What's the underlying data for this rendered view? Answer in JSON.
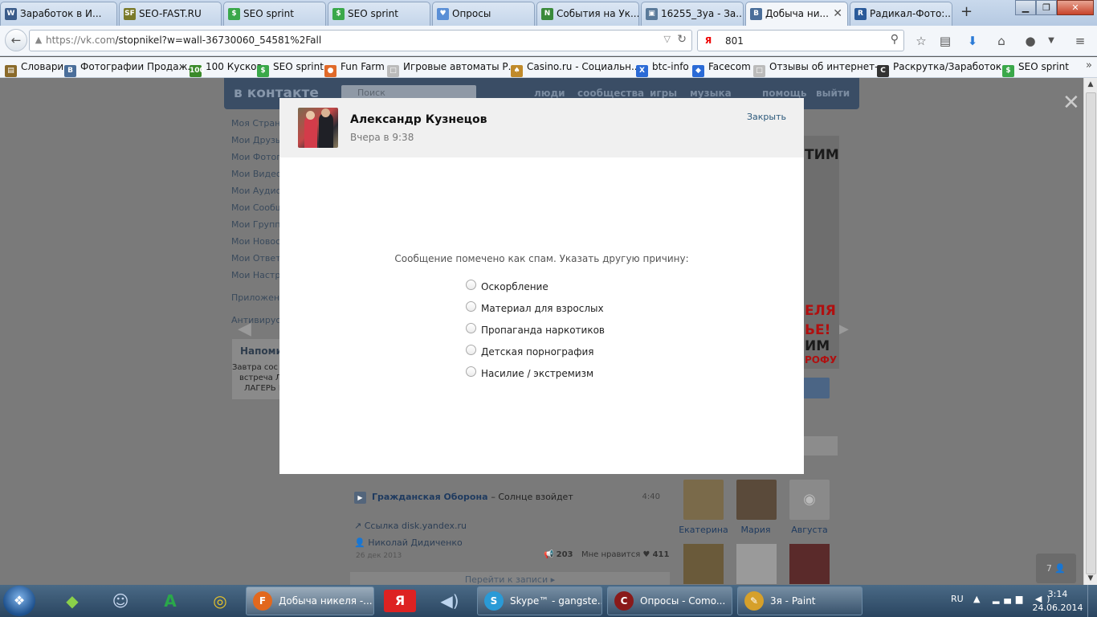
{
  "browser": {
    "tabs": [
      {
        "label": "Заработок в И...",
        "icon": "doll-zona-icon",
        "color": "#3b5c8a",
        "glyph": "W"
      },
      {
        "label": "SEO-FAST.RU",
        "icon": "seo-fast-icon",
        "color": "#7a7a2a",
        "glyph": "SF"
      },
      {
        "label": "SEO sprint",
        "icon": "seo-sprint-icon",
        "color": "#3aa84a",
        "glyph": "$"
      },
      {
        "label": "SEO sprint",
        "icon": "seo-sprint-icon",
        "color": "#3aa84a",
        "glyph": "$"
      },
      {
        "label": "Опросы",
        "icon": "heart-icon",
        "color": "#5a8fd6",
        "glyph": "♥"
      },
      {
        "label": "События на Ук...",
        "icon": "news-icon",
        "color": "#3a8a3a",
        "glyph": "N"
      },
      {
        "label": "16255_3уа - За...",
        "icon": "image-icon",
        "color": "#5a7a9a",
        "glyph": "▣"
      },
      {
        "label": "Добыча ни...",
        "icon": "vk-icon",
        "color": "#4a6e9a",
        "glyph": "B"
      },
      {
        "label": "Радикал-Фото:...",
        "icon": "radical-icon",
        "color": "#2a5a9a",
        "glyph": "R"
      }
    ],
    "url_host": "https://vk.com",
    "url_path": "/stopnikel?w=wall-36730060_54581%2Fall",
    "search_value": "801",
    "bookmarks": [
      {
        "label": "Словари",
        "color": "#8a6a2a",
        "glyph": "▤"
      },
      {
        "label": "Фотографии Продаж...",
        "color": "#4a6e9a",
        "glyph": "B"
      },
      {
        "label": "100 Кусков",
        "color": "#3a8a2a",
        "glyph": "100"
      },
      {
        "label": "SEO sprint",
        "color": "#3aa84a",
        "glyph": "$"
      },
      {
        "label": "Fun Farm",
        "color": "#e06a2a",
        "glyph": "●"
      },
      {
        "label": "Игровые автоматы Р...",
        "color": "#bbbbbb",
        "glyph": "□"
      },
      {
        "label": "Casino.ru - Социальн...",
        "color": "#c08a2a",
        "glyph": "♠"
      },
      {
        "label": "btc-info",
        "color": "#2a6ad6",
        "glyph": "X"
      },
      {
        "label": "Facecom",
        "color": "#2a6ad6",
        "glyph": "◆"
      },
      {
        "label": "Отзывы об интернет-...",
        "color": "#bbbbbb",
        "glyph": "□"
      },
      {
        "label": "Раскрутка/Заработок...",
        "color": "#333333",
        "glyph": "C"
      },
      {
        "label": "SEO sprint",
        "color": "#3aa84a",
        "glyph": "$"
      }
    ]
  },
  "vk": {
    "logo": "контакте",
    "search_placeholder": "Поиск",
    "nav": [
      "люди",
      "сообщества",
      "игры",
      "музыка",
      "помощь",
      "выйти"
    ],
    "left_menu": [
      "Моя Страница",
      "Мои Друзья",
      "Мои Фотографии",
      "Мои Видеозаписи",
      "Мои Аудиозаписи",
      "Мои Сообщения",
      "Мои Группы",
      "Мои Новости",
      "Мои Ответы",
      "Мои Настройки"
    ],
    "left_menu_extra": [
      "Приложения",
      "Антивирус"
    ],
    "reminder_title": "Напоминание",
    "reminder_lines": [
      "Завтра сос",
      "встреча Л",
      "ЛАГЕРЬ Р"
    ],
    "ad_lines": [
      "ТИМ",
      "ЕЛЯ",
      "ЬЕ!",
      "ИМ",
      "РОФУ"
    ],
    "audio": {
      "artist": "Гражданская Оборона",
      "song": "Солнце взойдет",
      "duration": "4:40"
    },
    "link": "Ссылка disk.yandex.ru",
    "author": "Николай Дидиченко",
    "post_date": "26 дек 2013",
    "reposts": "203",
    "likes_label": "Мне нравится",
    "likes": "411",
    "more_posts": "Перейти к записи",
    "friends": [
      "Екатерина",
      "Мария",
      "Августа"
    ],
    "counter": "7"
  },
  "modal": {
    "name": "Александр Кузнецов",
    "time": "Вчера в 9:38",
    "close": "Закрыть",
    "message": "Сообщение помечено как спам. Указать другую причину:",
    "reasons": [
      "Оскорбление",
      "Материал для взрослых",
      "Пропаганда наркотиков",
      "Детская порнография",
      "Насилие / экстремизм"
    ]
  },
  "taskbar": {
    "apps": [
      {
        "label": "Добыча никеля -...",
        "icon": "firefox-icon",
        "color": "#e2681e",
        "glyph": "F",
        "active": true
      },
      {
        "label": "Skype™ - gangste...",
        "icon": "skype-icon",
        "color": "#2a9ad6",
        "glyph": "S"
      },
      {
        "label": "Опросы - Como...",
        "icon": "comodo-icon",
        "color": "#8a1a1a",
        "glyph": "C"
      },
      {
        "label": "3я - Paint",
        "icon": "paint-icon",
        "color": "#d6a02a",
        "glyph": "✎"
      }
    ],
    "lang": "RU",
    "time": "3:14",
    "date": "24.06.2014"
  }
}
